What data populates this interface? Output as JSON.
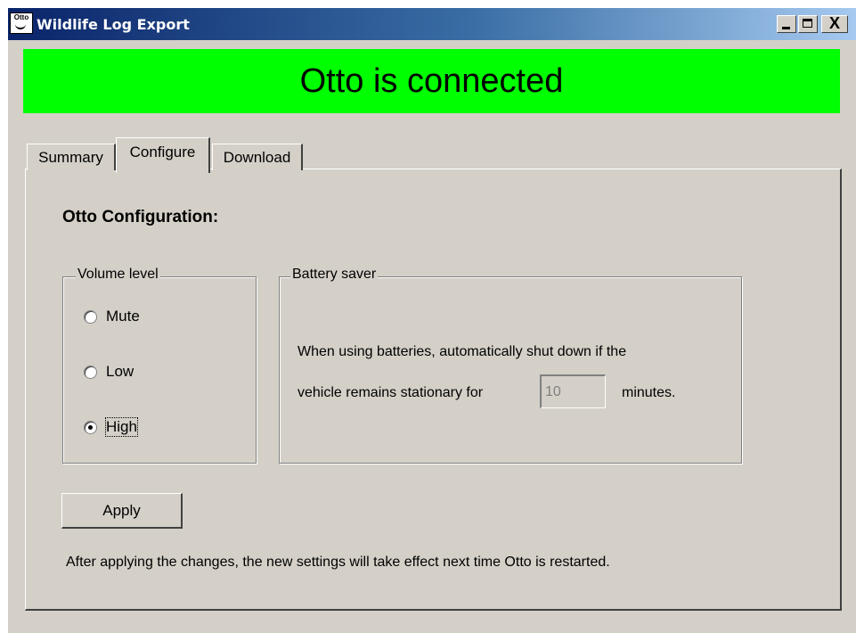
{
  "window": {
    "app_icon_text": "Otto",
    "title": "Wildlife Log Export",
    "close_glyph": "X"
  },
  "banner": {
    "text": "Otto is connected",
    "color": "#00ff00"
  },
  "tabs": [
    {
      "label": "Summary",
      "selected": false
    },
    {
      "label": "Configure",
      "selected": true
    },
    {
      "label": "Download",
      "selected": false
    }
  ],
  "config": {
    "title": "Otto Configuration:",
    "volume": {
      "legend": "Volume level",
      "options": [
        {
          "label": "Mute",
          "checked": false
        },
        {
          "label": "Low",
          "checked": false
        },
        {
          "label": "High",
          "checked": true
        }
      ]
    },
    "battery": {
      "legend": "Battery saver",
      "line1": "When using batteries, automatically shut down if the",
      "line2_prefix": "vehicle remains stationary for",
      "minutes_value": "10",
      "line2_suffix": "minutes."
    },
    "apply_label": "Apply",
    "note": "After applying the changes, the new settings will take effect next time Otto is restarted."
  }
}
